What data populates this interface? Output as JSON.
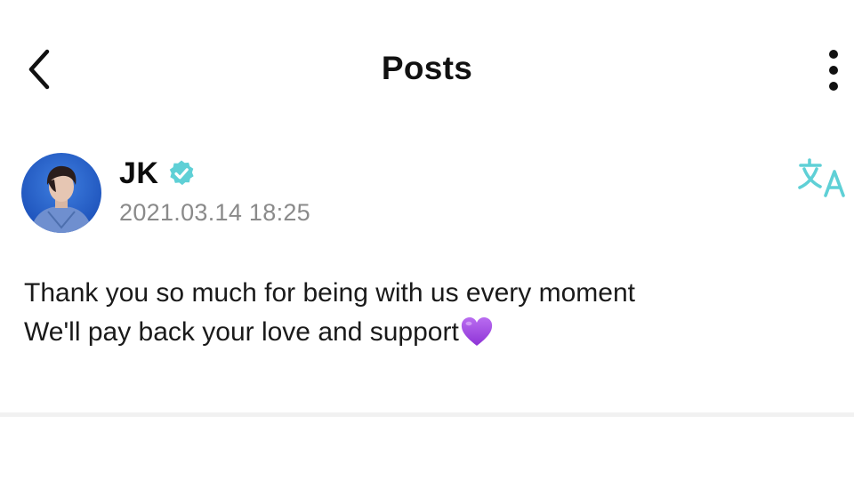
{
  "header": {
    "title": "Posts",
    "back_icon": "chevron-left-icon",
    "more_icon": "vertical-ellipsis-icon"
  },
  "post": {
    "author": "JK",
    "verified_icon": "verified-badge-icon",
    "timestamp": "2021.03.14 18:25",
    "translate_icon": "translate-icon",
    "lines": [
      "Thank you so much for being with us every moment",
      "We'll pay back your love and support"
    ],
    "emoji": "purple-heart-icon"
  },
  "colors": {
    "accent": "#5fd0d6",
    "timestamp": "#8a8a8a",
    "heart": "#a34de0",
    "divider": "#f1f1f1"
  }
}
